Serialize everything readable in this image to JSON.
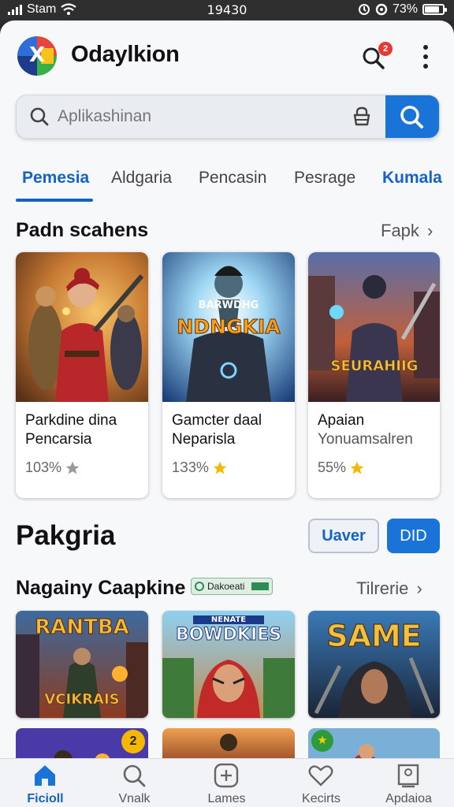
{
  "status_bar": {
    "carrier": "Stam",
    "time": "19430",
    "battery": "73%",
    "battery_level": 0.73
  },
  "app": {
    "title": "Odaylkion",
    "notification_count": "2"
  },
  "search": {
    "placeholder": "Aplikashinan"
  },
  "tabs": [
    {
      "label": "Pemesia",
      "active": true
    },
    {
      "label": "Aldgaria"
    },
    {
      "label": "Pencasin"
    },
    {
      "label": "Pesrage"
    },
    {
      "label": "Kumala"
    }
  ],
  "section1": {
    "title": "Padn scahens",
    "link": "Fapk"
  },
  "cards": [
    {
      "art_title": "",
      "name": "Parkdine dina Pencarsia",
      "rating": "103%"
    },
    {
      "art_title": "NDNGKIA",
      "art_subtitle": "BARWDHG",
      "name": "Gamcter daal Neparisla",
      "rating": "1З3%"
    },
    {
      "art_title": "SEURAHIIG",
      "name": "Apaian Yonuamsalren",
      "rating": "55%"
    }
  ],
  "section2": {
    "title": "Pakgria",
    "btn_outline": "Uaver",
    "btn_solid": "DID"
  },
  "section3": {
    "title": "Nagainy Caapkine",
    "badge": "Dakoeati",
    "link": "Tilrerie"
  },
  "thumbs": [
    {
      "title": "RANTBA",
      "subtitle": "VCIKRAIS"
    },
    {
      "title": "BOWDKIES",
      "subtitle": "NENATE"
    },
    {
      "title": "SAME"
    }
  ],
  "thumb_row2_badges": [
    "2",
    "★"
  ],
  "bottom_nav": [
    {
      "label": "Ficioll",
      "icon": "home-icon",
      "active": true
    },
    {
      "label": "Vnalk",
      "icon": "search-icon"
    },
    {
      "label": "Lames",
      "icon": "add-icon"
    },
    {
      "label": "Kecirts",
      "icon": "heart-icon"
    },
    {
      "label": "Apdaioa",
      "icon": "profile-icon"
    }
  ],
  "colors": {
    "accent": "#1a74d8",
    "accent_text": "#1463c4",
    "star_gold": "#f5b800",
    "star_gray": "#9a9a9a"
  }
}
